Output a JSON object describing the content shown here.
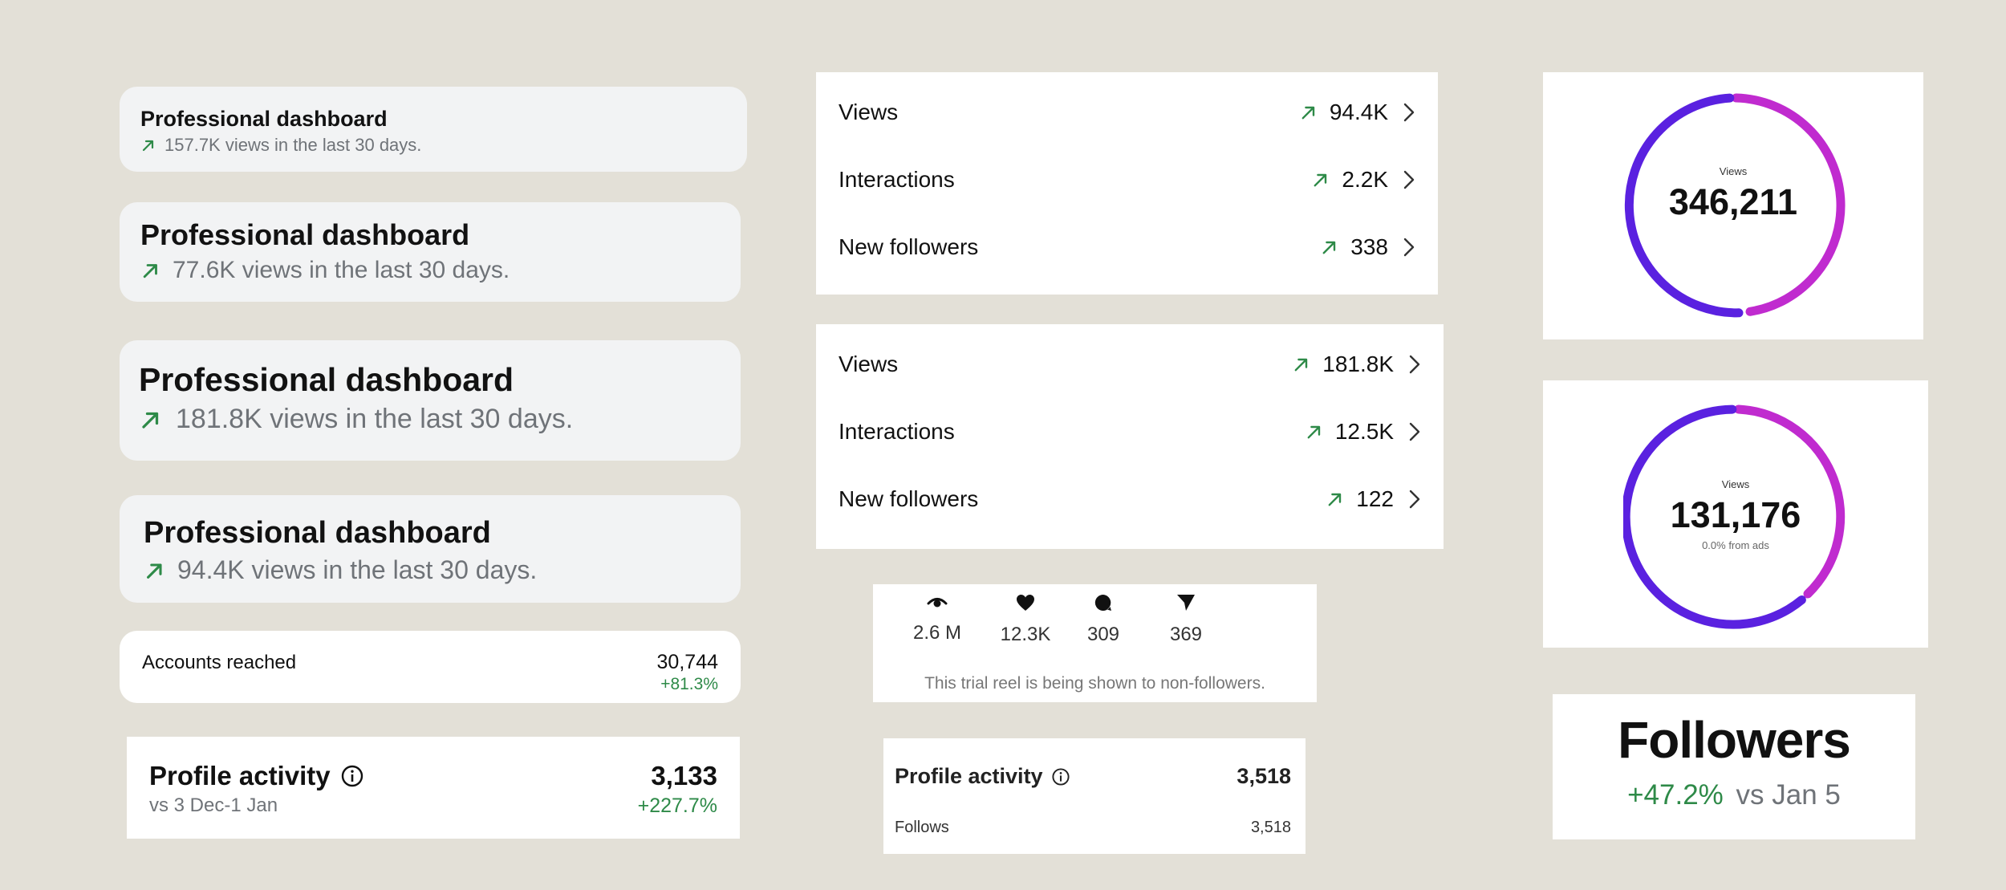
{
  "dashboards": [
    {
      "title": "Professional dashboard",
      "subtitle": "157.7K views in the last 30 days."
    },
    {
      "title": "Professional dashboard",
      "subtitle": "77.6K views in the last 30 days."
    },
    {
      "title": "Professional dashboard",
      "subtitle": "181.8K views in the last 30 days."
    },
    {
      "title": "Professional dashboard",
      "subtitle": "94.4K views in the last 30 days."
    }
  ],
  "accounts_reached": {
    "label": "Accounts reached",
    "value": "30,744",
    "change": "+81.3%"
  },
  "profile_activity_1": {
    "title": "Profile activity",
    "subtitle": "vs 3 Dec-1 Jan",
    "value": "3,133",
    "change": "+227.7%"
  },
  "metrics_1": [
    {
      "label": "Views",
      "value": "94.4K"
    },
    {
      "label": "Interactions",
      "value": "2.2K"
    },
    {
      "label": "New followers",
      "value": "338"
    }
  ],
  "metrics_2": [
    {
      "label": "Views",
      "value": "181.8K"
    },
    {
      "label": "Interactions",
      "value": "12.5K"
    },
    {
      "label": "New followers",
      "value": "122"
    }
  ],
  "reel_stats": {
    "items": [
      {
        "icon": "eye-icon",
        "value": "2.6 M"
      },
      {
        "icon": "heart-icon",
        "value": "12.3K"
      },
      {
        "icon": "comment-icon",
        "value": "309"
      },
      {
        "icon": "share-icon",
        "value": "369"
      }
    ],
    "note": "This trial reel is being shown to non-followers."
  },
  "profile_activity_2": {
    "title": "Profile activity",
    "value": "3,518",
    "row_label": "Follows",
    "row_value": "3,518"
  },
  "donut_1": {
    "label": "Views",
    "value": "346,211"
  },
  "donut_2": {
    "label": "Views",
    "value": "131,176",
    "sub": "0.0% from ads"
  },
  "followers": {
    "title": "Followers",
    "change": "+47.2%",
    "suffix": "vs Jan 5"
  },
  "colors": {
    "accent_green": "#2e8a48",
    "donut_purple": "#5b22e0",
    "donut_magenta": "#c22ad0",
    "card_gray": "#f2f3f4",
    "background": "#e3e0d7"
  }
}
